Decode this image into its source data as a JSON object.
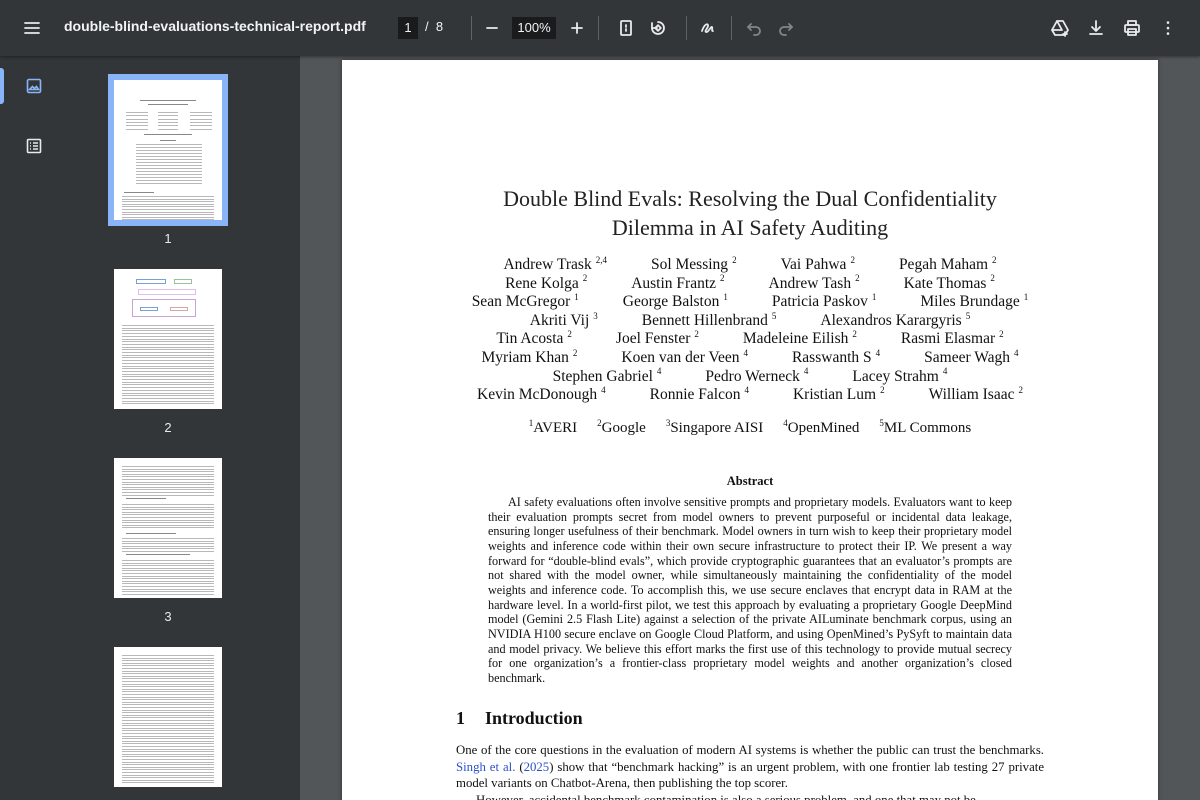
{
  "toolbar": {
    "title": "double-blind-evaluations-technical-report.pdf",
    "current_page": "1",
    "page_separator": "/",
    "total_pages": "8",
    "zoom": "100%"
  },
  "sidebar": {
    "thumbnails": [
      {
        "label": "1"
      },
      {
        "label": "2"
      },
      {
        "label": "3"
      }
    ]
  },
  "document": {
    "title_line1": "Double Blind Evals: Resolving the Dual Confidentiality",
    "title_line2": "Dilemma in AI Safety Auditing",
    "author_rows": [
      [
        [
          "Andrew Trask",
          "2,4"
        ],
        [
          "Sol Messing",
          "2"
        ],
        [
          "Vai Pahwa",
          "2"
        ],
        [
          "Pegah Maham",
          "2"
        ]
      ],
      [
        [
          "Rene Kolga",
          "2"
        ],
        [
          "Austin Frantz",
          "2"
        ],
        [
          "Andrew Tash",
          "2"
        ],
        [
          "Kate Thomas",
          "2"
        ]
      ],
      [
        [
          "Sean McGregor",
          "1"
        ],
        [
          "George Balston",
          "1"
        ],
        [
          "Patricia Paskov",
          "1"
        ],
        [
          "Miles Brundage",
          "1"
        ]
      ],
      [
        [
          "Akriti Vij",
          "3"
        ],
        [
          "Bennett Hillenbrand",
          "5"
        ],
        [
          "Alexandros Karargyris",
          "5"
        ]
      ],
      [
        [
          "Tin Acosta",
          "2"
        ],
        [
          "Joel Fenster",
          "2"
        ],
        [
          "Madeleine Eilish",
          "2"
        ],
        [
          "Rasmi Elasmar",
          "2"
        ]
      ],
      [
        [
          "Myriam Khan",
          "2"
        ],
        [
          "Koen van der Veen",
          "4"
        ],
        [
          "Rasswanth S",
          "4"
        ],
        [
          "Sameer Wagh",
          "4"
        ]
      ],
      [
        [
          "Stephen Gabriel",
          "4"
        ],
        [
          "Pedro Werneck",
          "4"
        ],
        [
          "Lacey Strahm",
          "4"
        ]
      ],
      [
        [
          "Kevin McDonough",
          "4"
        ],
        [
          "Ronnie Falcon",
          "4"
        ],
        [
          "Kristian Lum",
          "2"
        ],
        [
          "William Isaac",
          "2"
        ]
      ]
    ],
    "affiliations": [
      [
        "1",
        "AVERI"
      ],
      [
        "2",
        "Google"
      ],
      [
        "3",
        "Singapore AISI"
      ],
      [
        "4",
        "OpenMined"
      ],
      [
        "5",
        "ML Commons"
      ]
    ],
    "abstract_heading": "Abstract",
    "abstract": "AI safety evaluations often involve sensitive prompts and proprietary models. Evaluators want to keep their evaluation prompts secret from model owners to prevent purposeful or incidental data leakage, ensuring longer usefulness of their benchmark. Model owners in turn wish to keep their proprietary model weights and inference code within their own secure infrastructure to protect their IP. We present a way forward for “double-blind evals”, which provide cryptographic guarantees that an evaluator’s prompts are not shared with the model owner, while simultaneously maintaining the confidentiality of the model weights and inference code. To accomplish this, we use secure enclaves that encrypt data in RAM at the hardware level. In a world-first pilot, we test this approach by evaluating a proprietary Google DeepMind model (Gemini 2.5 Flash Lite) against a selection of the private AILuminate benchmark corpus, using an NVIDIA H100 secure enclave on Google Cloud Platform, and using OpenMined’s PySyft to maintain data and model privacy. We believe this effort marks the first use of this technology to provide mutual secrecy for one organization’s a frontier-class proprietary model weights and another organization’s closed benchmark.",
    "section_number": "1",
    "section_title": "Introduction",
    "intro_p1_before": "One of the core questions in the evaluation of modern AI systems is whether the public can trust the benchmarks. ",
    "intro_p1_cite": "Singh et al.",
    "intro_p1_year": "2025",
    "intro_p1_after": " show that “benchmark hacking” is an urgent problem, with one frontier lab testing 27 private model variants on Chatbot-Arena, then publishing the top scorer.",
    "intro_p2": "However, accidental benchmark contamination is also a serious problem, and one that may not be"
  },
  "colors": {
    "toolbar_bg": "#323639",
    "viewer_bg": "#525659",
    "accent": "#8ab4f8",
    "citation": "#2b52c9"
  },
  "icons": [
    "menu-icon",
    "zoom-out-icon",
    "zoom-in-icon",
    "fit-page-icon",
    "rotate-icon",
    "annotate-icon",
    "undo-icon",
    "redo-icon",
    "drive-icon",
    "download-icon",
    "print-icon",
    "more-vert-icon",
    "thumbnails-icon",
    "outline-icon"
  ]
}
